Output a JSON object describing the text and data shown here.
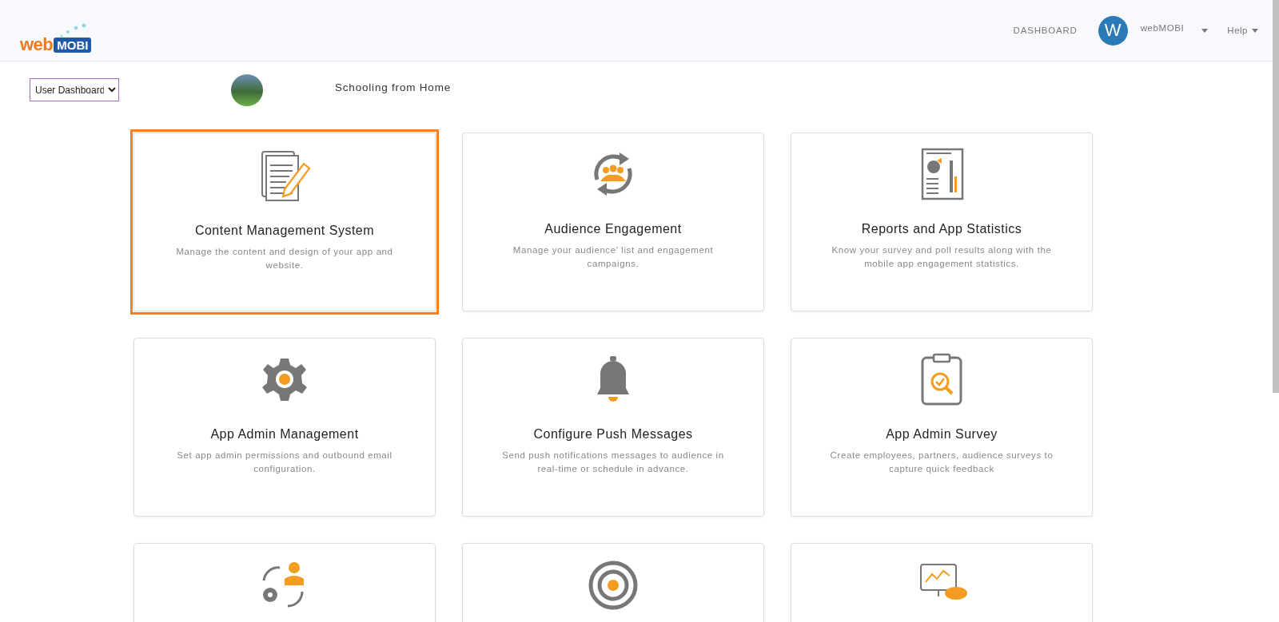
{
  "header": {
    "logo": {
      "part_1": "web",
      "part_2": "MOBI"
    },
    "nav": [
      {
        "kind": "link",
        "label": "DASHBOARD"
      },
      {
        "kind": "user",
        "avatar_letter": "W",
        "label": "webMOBI"
      },
      {
        "kind": "menu",
        "label": "Help"
      }
    ]
  },
  "toolbar": {
    "view_select": {
      "value": "User Dashboard"
    },
    "app_title": "Schooling from Home"
  },
  "cards": [
    {
      "kind": "document-pencil",
      "title": "Content Management System",
      "description": "Manage the content and design of your app and website.",
      "selected": true
    },
    {
      "kind": "audience-cycle",
      "title": "Audience Engagement",
      "description": "Manage your audience' list and engagement campaigns.",
      "selected": false
    },
    {
      "kind": "report",
      "title": "Reports and App Statistics",
      "description": "Know your survey and poll results along with the mobile app engagement statistics.",
      "selected": false
    },
    {
      "kind": "gear",
      "title": "App Admin Management",
      "description": "Set app admin permissions and outbound email configuration.",
      "selected": false
    },
    {
      "kind": "bell",
      "title": "Configure Push Messages",
      "description": "Send push notifications messages to audience in real-time or schedule in advance.",
      "selected": false
    },
    {
      "kind": "clipboard-search",
      "title": "App Admin Survey",
      "description": "Create employees, partners, audience surveys to capture quick feedback",
      "selected": false
    },
    {
      "kind": "user-gear-cycle",
      "selected": false
    },
    {
      "kind": "broadcast",
      "selected": false
    },
    {
      "kind": "monitor-cloud",
      "selected": false
    }
  ]
}
